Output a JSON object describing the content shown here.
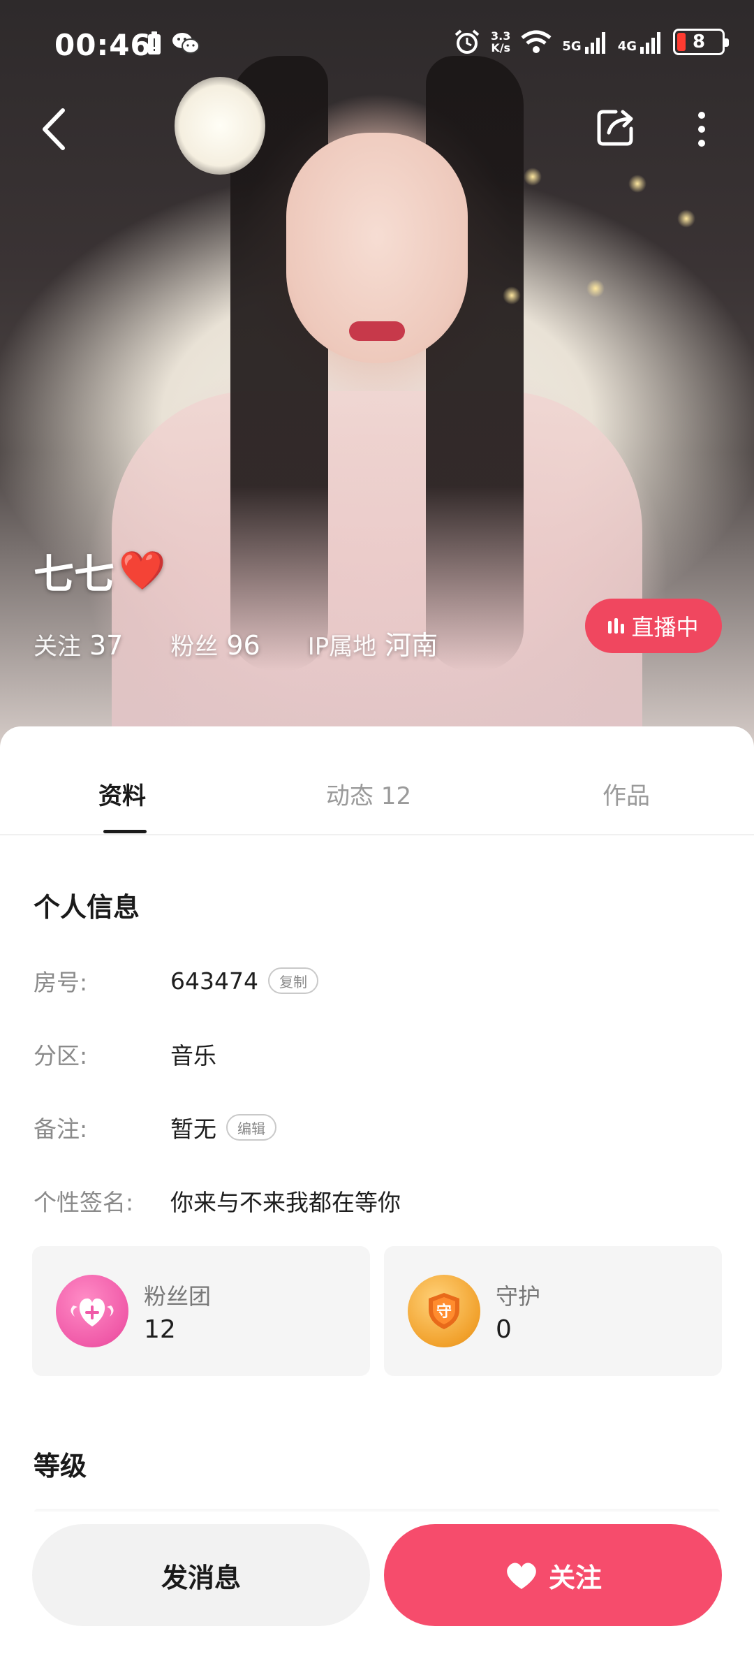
{
  "status_bar": {
    "time": "00:46",
    "net_speed_top": "3.3",
    "net_speed_bottom": "K/s",
    "sig1": "5G",
    "sig2": "4G",
    "battery": "8"
  },
  "profile": {
    "name": "七七",
    "name_emoji": "❤️",
    "following_label": "关注",
    "following_count": "37",
    "fans_label": "粉丝",
    "fans_count": "96",
    "ip_label": "IP属地",
    "ip_value": "河南",
    "live_label": "直播中"
  },
  "tabs": [
    {
      "label": "资料"
    },
    {
      "label": "动态 12"
    },
    {
      "label": "作品"
    }
  ],
  "personal_info": {
    "title": "个人信息",
    "rows": [
      {
        "label": "房号:",
        "value": "643474",
        "action": "复制"
      },
      {
        "label": "分区:",
        "value": "音乐"
      },
      {
        "label": "备注:",
        "value": "暂无",
        "action": "编辑"
      },
      {
        "label": "个性签名:",
        "value": "你来与不来我都在等你"
      }
    ]
  },
  "cards": [
    {
      "label": "粉丝团",
      "value": "12",
      "icon": "fan-club-heart-icon",
      "color": "#f05aa8"
    },
    {
      "label": "守护",
      "value": "0",
      "icon": "guard-shield-icon",
      "color": "#f1a12c",
      "icon_text": "守"
    }
  ],
  "level": {
    "title": "等级"
  },
  "bottom": {
    "message_label": "发消息",
    "follow_label": "关注"
  },
  "colors": {
    "accent": "#f64c6c",
    "live": "#f0475f"
  }
}
